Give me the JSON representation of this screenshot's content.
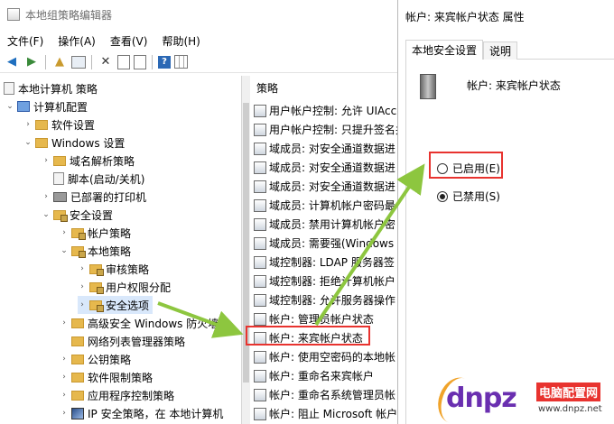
{
  "main_window": {
    "title": "本地组策略编辑器",
    "menu": [
      "文件(F)",
      "操作(A)",
      "查看(V)",
      "帮助(H)"
    ],
    "toolbar_icons": [
      "back-arrow-icon",
      "forward-arrow-icon",
      "up-folder-icon",
      "show-hide-tree-icon",
      "delete-icon",
      "properties-icon",
      "export-icon",
      "help-icon",
      "view-icon"
    ]
  },
  "tree": {
    "items": [
      {
        "label": "本地计算机 策略",
        "icon": "page-icon"
      },
      {
        "label": "计算机配置",
        "icon": "computer-icon"
      },
      {
        "label": "软件设置",
        "icon": "folder-icon"
      },
      {
        "label": "Windows 设置",
        "icon": "folder-icon"
      },
      {
        "label": "域名解析策略",
        "icon": "folder-icon"
      },
      {
        "label": "脚本(启动/关机)",
        "icon": "page-icon"
      },
      {
        "label": "已部署的打印机",
        "icon": "printer-icon"
      },
      {
        "label": "安全设置",
        "icon": "security-folder-icon"
      },
      {
        "label": "帐户策略",
        "icon": "folder-icon"
      },
      {
        "label": "本地策略",
        "icon": "folder-icon"
      },
      {
        "label": "审核策略",
        "icon": "folder-icon"
      },
      {
        "label": "用户权限分配",
        "icon": "folder-icon"
      },
      {
        "label": "安全选项",
        "icon": "folder-icon"
      },
      {
        "label": "高级安全 Windows 防火墙",
        "icon": "folder-icon"
      },
      {
        "label": "网络列表管理器策略",
        "icon": "folder-icon"
      },
      {
        "label": "公钥策略",
        "icon": "folder-icon"
      },
      {
        "label": "软件限制策略",
        "icon": "folder-icon"
      },
      {
        "label": "应用程序控制策略",
        "icon": "folder-icon"
      },
      {
        "label": "IP 安全策略，在 本地计算机",
        "icon": "ip-security-icon"
      }
    ]
  },
  "policy_list": {
    "header": "策略",
    "rows": [
      "用户帐户控制: 允许 UIAccess",
      "用户帐户控制: 只提升签名并",
      "域成员: 对安全通道数据进",
      "域成员: 对安全通道数据进",
      "域成员: 对安全通道数据进",
      "域成员: 计算机帐户密码最",
      "域成员: 禁用计算机帐户密",
      "域成员: 需要强(Windows",
      "域控制器: LDAP 服务器签",
      "域控制器: 拒绝计算机帐户",
      "域控制器: 允许服务器操作",
      "帐户: 管理员帐户状态",
      "帐户: 来宾帐户状态",
      "帐户: 使用空密码的本地帐",
      "帐户: 重命名来宾帐户",
      "帐户: 重命名系统管理员帐",
      "帐户: 阻止 Microsoft 帐户"
    ]
  },
  "dialog": {
    "title": "帐户: 来宾帐户状态 属性",
    "tabs": [
      "本地安全设置",
      "说明"
    ],
    "policy_name": "帐户: 来宾帐户状态",
    "options": [
      {
        "label": "已启用(E)",
        "selected": false
      },
      {
        "label": "已禁用(S)",
        "selected": true
      }
    ]
  },
  "watermark": {
    "brand": "dnpz",
    "brand_cn": "电脑配置网",
    "url": "www.dnpz.net"
  },
  "colors": {
    "highlight": "#e8332f",
    "arrow": "#8dc63f",
    "selection": "#d9e8fb"
  }
}
